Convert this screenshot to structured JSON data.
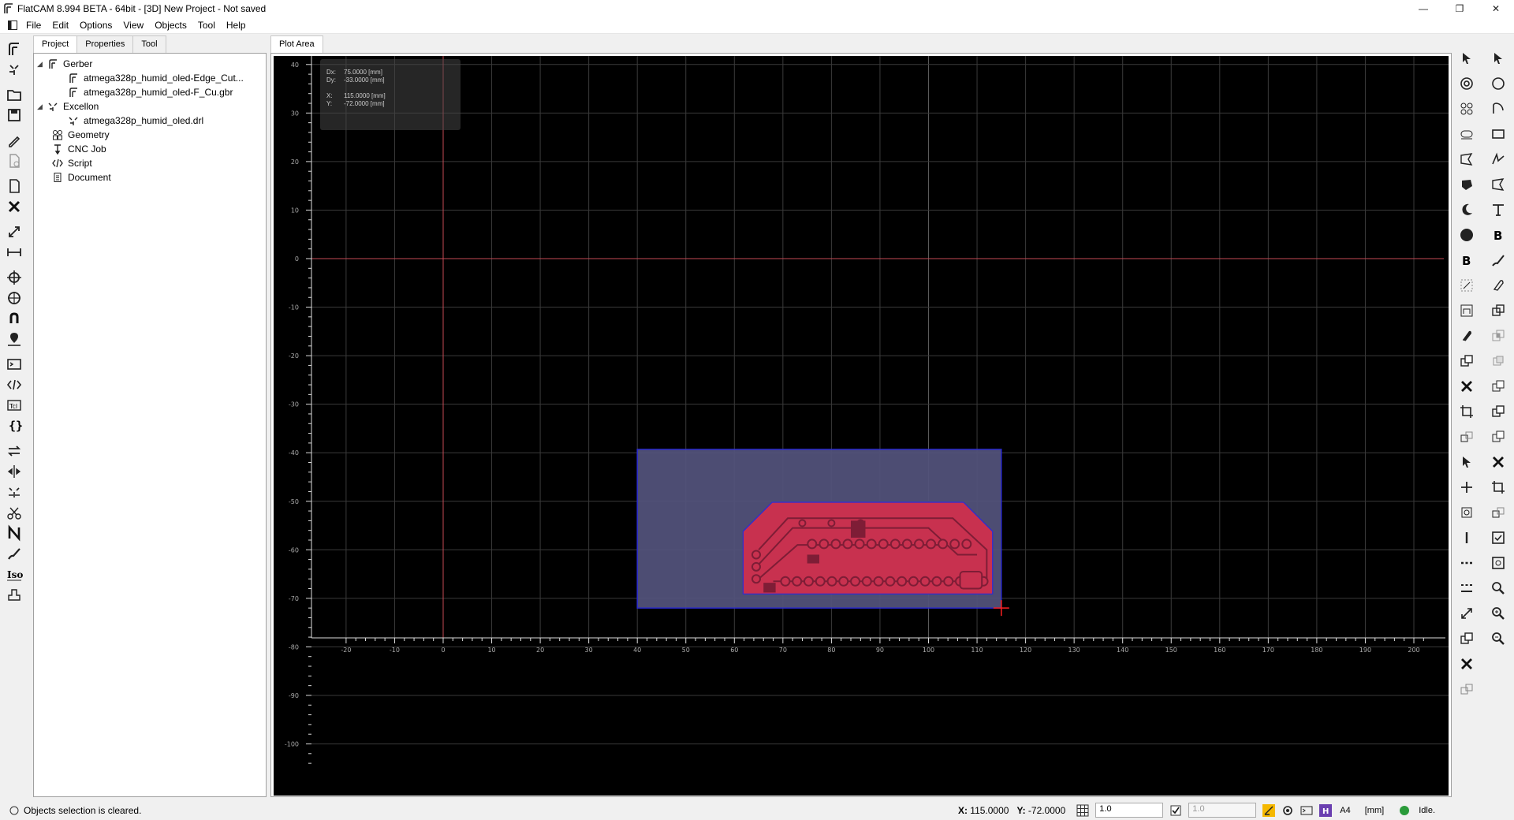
{
  "window": {
    "title": "FlatCAM 8.994 BETA - 64bit - [3D]     New Project - Not saved",
    "controls": [
      "minimize",
      "restore",
      "close"
    ]
  },
  "menu": {
    "items": [
      "File",
      "Edit",
      "Options",
      "View",
      "Objects",
      "Tool",
      "Help"
    ]
  },
  "notebook": {
    "tabs": [
      "Project",
      "Properties",
      "Tool"
    ],
    "active_tab": "Project"
  },
  "project_tree": {
    "gerber": {
      "label": "Gerber",
      "children": [
        "atmega328p_humid_oled-Edge_Cut...",
        "atmega328p_humid_oled-F_Cu.gbr"
      ]
    },
    "excellon": {
      "label": "Excellon",
      "children": [
        "atmega328p_humid_oled.drl"
      ]
    },
    "geometry": "Geometry",
    "cnc_job": "CNC Job",
    "script": "Script",
    "document": "Document"
  },
  "plot_area": {
    "tab_label": "Plot Area",
    "axis_x_ticks": [
      "-20",
      "-10",
      "0",
      "10",
      "20",
      "30",
      "40",
      "50",
      "60",
      "70",
      "80",
      "90",
      "100",
      "110",
      "120",
      "130",
      "140",
      "150",
      "160",
      "170",
      "180",
      "190",
      "200"
    ],
    "axis_y_ticks": [
      "40",
      "30",
      "20",
      "10",
      "0",
      "-10",
      "-20",
      "-30",
      "-40",
      "-50",
      "-60",
      "-70",
      "-80",
      "-90",
      "-100"
    ],
    "coord_box": {
      "dx_label": "Dx:",
      "dx_value": "75.0000 [mm]",
      "dy_label": "Dy:",
      "dy_value": "-33.0000 [mm]",
      "x_label": "X:",
      "x_value": "115.0000 [mm]",
      "y_label": "Y:",
      "y_value": "-72.0000 [mm]"
    },
    "colors": {
      "background": "#000000",
      "grid": "#3a3a3a",
      "axis": "#c44a55",
      "selection_fill": "#52527a",
      "selection_border": "#2b2bd6",
      "copper": "#c8314f",
      "copper_dark": "#7e1d36"
    }
  },
  "statusbar": {
    "message": "Objects selection is cleared.",
    "x_label": "X:",
    "x_value": "115.0000",
    "y_label": "Y:",
    "y_value": "-72.0000",
    "grid_x": "1.0",
    "grid_y": "1.0",
    "page_size": "A4",
    "units": "[mm]",
    "state": "Idle."
  }
}
